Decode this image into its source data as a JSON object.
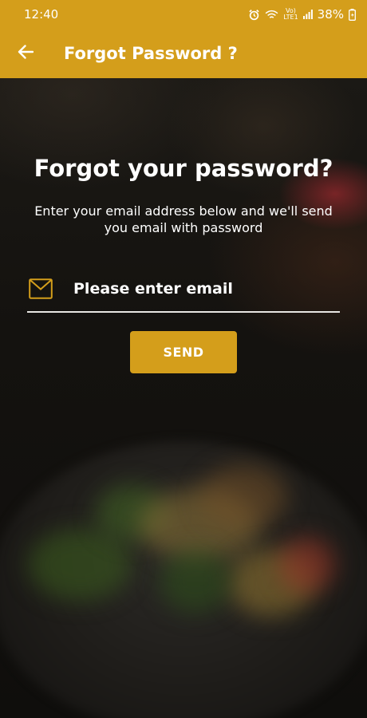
{
  "status_bar": {
    "time": "12:40",
    "signal_label_top": "Vo)",
    "signal_label_bottom": "LTE1",
    "battery": "38%"
  },
  "app_bar": {
    "title": "Forgot Password ?",
    "back_icon": "arrow-left-icon"
  },
  "main": {
    "heading": "Forgot your password?",
    "description": "Enter your email address below and we'll send you email with password",
    "email": {
      "placeholder": "Please enter email",
      "value": "",
      "icon": "mail-icon"
    },
    "send_label": "SEND"
  },
  "colors": {
    "accent": "#d49e1b",
    "text": "#ffffff"
  }
}
